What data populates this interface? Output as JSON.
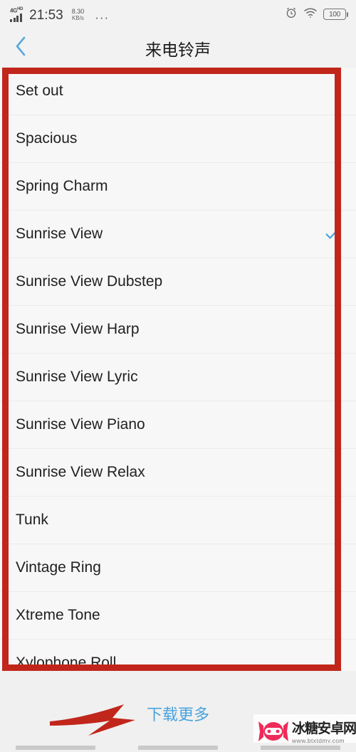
{
  "status_bar": {
    "network_type": "4G",
    "network_suffix": "HD",
    "time": "21:53",
    "data_speed_value": "8.30",
    "data_speed_unit": "KB/s",
    "overflow_dots": "···",
    "alarm_icon": "alarm-clock-icon",
    "wifi_icon": "wifi-icon",
    "battery_level": "100"
  },
  "app_bar": {
    "back_icon": "chevron-left-icon",
    "title": "来电铃声"
  },
  "ringtones": {
    "items": [
      {
        "label": "Set out",
        "selected": false
      },
      {
        "label": "Spacious",
        "selected": false
      },
      {
        "label": "Spring Charm",
        "selected": false
      },
      {
        "label": "Sunrise View",
        "selected": true
      },
      {
        "label": "Sunrise View Dubstep",
        "selected": false
      },
      {
        "label": "Sunrise View Harp",
        "selected": false
      },
      {
        "label": "Sunrise View Lyric",
        "selected": false
      },
      {
        "label": "Sunrise View Piano",
        "selected": false
      },
      {
        "label": "Sunrise View Relax",
        "selected": false
      },
      {
        "label": "Tunk",
        "selected": false
      },
      {
        "label": "Vintage Ring",
        "selected": false
      },
      {
        "label": "Xtreme Tone",
        "selected": false
      },
      {
        "label": "Xylophone Roll",
        "selected": false
      }
    ],
    "check_icon": "check-icon",
    "check_color": "#4aa3dd"
  },
  "bottom": {
    "download_more_label": "下载更多",
    "download_more_color": "#4aa3dd"
  },
  "annotations": {
    "highlight_color": "#c1261b",
    "box_name": "ringtone-list-highlight",
    "arrow_name": "download-more-arrow"
  },
  "watermark": {
    "logo_icon": "ninja-face-logo-icon",
    "site_name": "冰糖安卓网",
    "site_url": "www.btxtdmy.com",
    "brand_color": "#ef2b5a"
  },
  "nav_bar": {
    "keys": [
      "back-key",
      "home-key",
      "recents-key"
    ]
  }
}
